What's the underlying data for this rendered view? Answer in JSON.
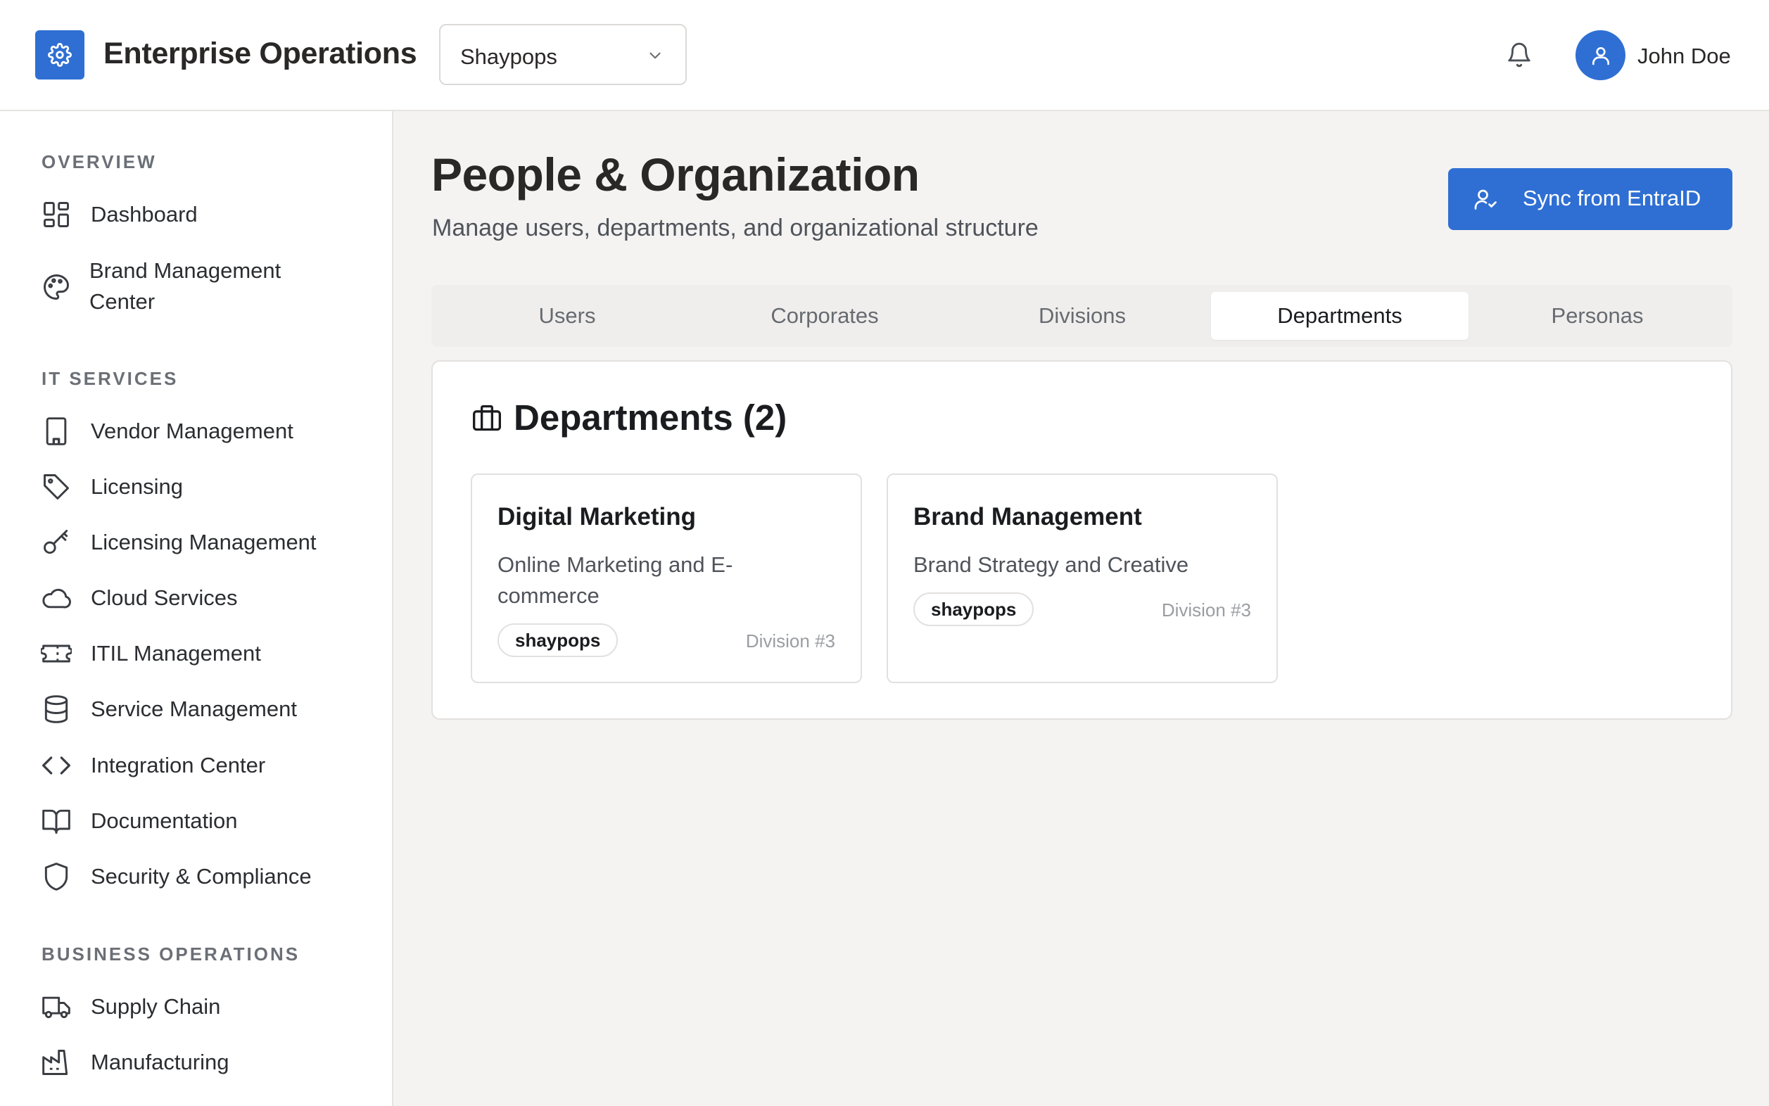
{
  "header": {
    "app_title": "Enterprise Operations",
    "org_selected": "Shaypops",
    "user_name": "John Doe"
  },
  "sidebar": {
    "sections": [
      {
        "label": "OVERVIEW"
      },
      {
        "label": "IT SERVICES"
      },
      {
        "label": "BUSINESS OPERATIONS"
      }
    ],
    "items": [
      {
        "label": "Dashboard",
        "icon": "dashboard-icon"
      },
      {
        "label_line1": "Brand Management",
        "label_line2": "Center",
        "icon": "palette-icon"
      },
      {
        "label": "Vendor Management",
        "icon": "building-icon"
      },
      {
        "label": "Licensing",
        "icon": "tag-icon"
      },
      {
        "label": "Licensing Management",
        "icon": "key-icon"
      },
      {
        "label": "Cloud Services",
        "icon": "cloud-icon"
      },
      {
        "label": "ITIL Management",
        "icon": "ticket-icon"
      },
      {
        "label": "Service Management",
        "icon": "database-icon"
      },
      {
        "label": "Integration Center",
        "icon": "code-icon"
      },
      {
        "label": "Documentation",
        "icon": "book-icon"
      },
      {
        "label": "Security & Compliance",
        "icon": "shield-icon"
      },
      {
        "label": "Supply Chain",
        "icon": "truck-icon"
      },
      {
        "label": "Manufacturing",
        "icon": "factory-icon"
      }
    ]
  },
  "main": {
    "title": "People & Organization",
    "subtitle": "Manage users, departments, and organizational structure",
    "sync_button": "Sync from EntraID",
    "tabs": [
      {
        "label": "Users",
        "active": false
      },
      {
        "label": "Corporates",
        "active": false
      },
      {
        "label": "Divisions",
        "active": false
      },
      {
        "label": "Departments",
        "active": true
      },
      {
        "label": "Personas",
        "active": false
      }
    ],
    "panel": {
      "title": "Departments (2)",
      "departments": [
        {
          "name": "Digital Marketing",
          "description": "Online Marketing and E-commerce",
          "badge": "shaypops",
          "division": "Division #3"
        },
        {
          "name": "Brand Management",
          "description": "Brand Strategy and Creative",
          "badge": "shaypops",
          "division": "Division #3"
        }
      ]
    }
  },
  "colors": {
    "accent": "#2f6fd3",
    "background": "#f4f3f2",
    "surface": "#ffffff",
    "muted_text": "#6b6f76"
  }
}
